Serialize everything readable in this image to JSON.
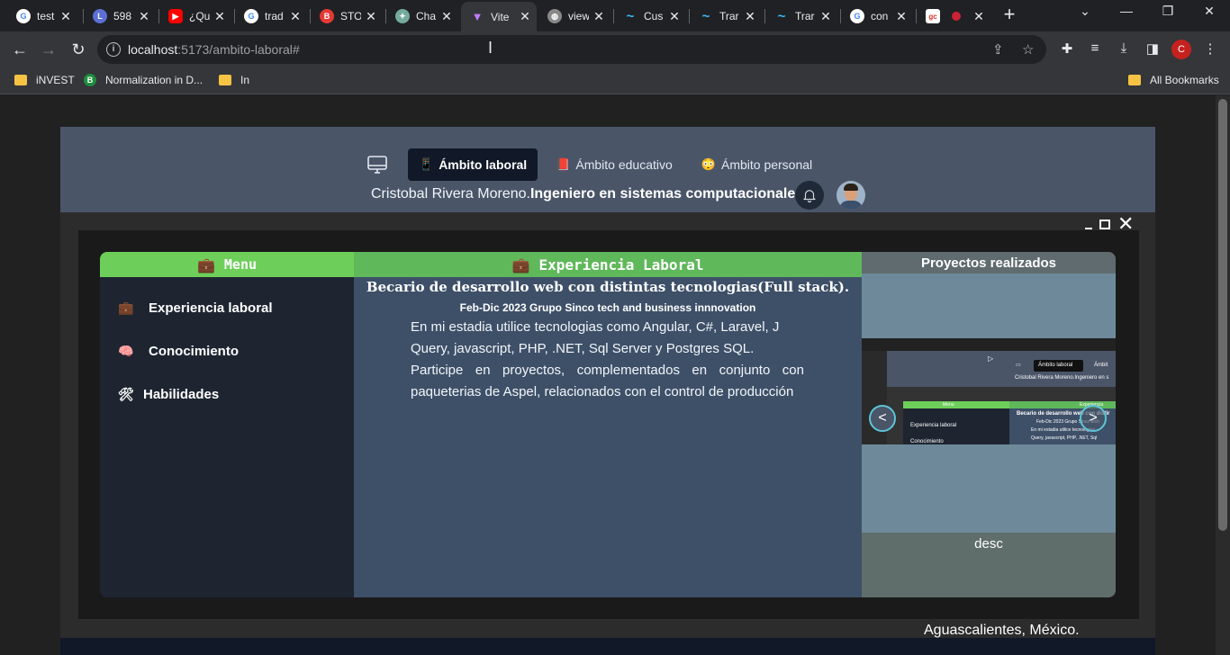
{
  "browser": {
    "tabs": [
      {
        "title": "test",
        "fav": "G",
        "color": "#4285f4"
      },
      {
        "title": "598",
        "fav": "L",
        "color": "#5b6fd6"
      },
      {
        "title": "¿Qu",
        "fav": "▶",
        "color": "#ff0000"
      },
      {
        "title": "trad",
        "fav": "G",
        "color": "#4285f4"
      },
      {
        "title": "STO",
        "fav": "B",
        "color": "#e53935"
      },
      {
        "title": "Cha",
        "fav": "✦",
        "color": "#74aa9c"
      },
      {
        "title": "Vite",
        "fav": "▼",
        "color": "#9c6bff"
      },
      {
        "title": "view",
        "fav": "◍",
        "color": "#888888"
      },
      {
        "title": "Cus",
        "fav": "~",
        "color": "#38bdf8"
      },
      {
        "title": "Trar",
        "fav": "~",
        "color": "#38bdf8"
      },
      {
        "title": "Trar",
        "fav": "~",
        "color": "#38bdf8"
      },
      {
        "title": "con",
        "fav": "G",
        "color": "#4285f4"
      },
      {
        "title": "",
        "fav": "gc",
        "color": "#d93025"
      }
    ],
    "url_host": "localhost",
    "url_path": ":5173/ambito-laboral#",
    "profile_initial": "C",
    "bookmarks": [
      "iNVEST",
      "Normalization in D...",
      "In"
    ],
    "all_bookmarks": "All Bookmarks"
  },
  "header": {
    "tabs": [
      {
        "emoji": "📱",
        "label": "Ámbito laboral"
      },
      {
        "emoji": "📕",
        "label": "Ámbito educativo"
      },
      {
        "emoji": "😳",
        "label": "Ámbito personal"
      }
    ],
    "name": "Cristobal Rivera Moreno.",
    "role": "Ingeniero en sistemas computacionales."
  },
  "menu": {
    "title": "Menu",
    "title_emoji": "💼",
    "items": [
      {
        "emoji": "💼",
        "label": "Experiencia laboral"
      },
      {
        "emoji": "🧠",
        "label": "Conocimiento"
      },
      {
        "emoji": "🛠",
        "label": "Habilidades"
      }
    ]
  },
  "experience": {
    "title": "Experiencia Laboral",
    "title_emoji": "💼",
    "job_title": "Becario de desarrollo web con distintas tecnologias(Full stack).",
    "subtitle": "Feb-Dic 2023 Grupo Sinco tech and business innnovation",
    "paragraph1": "En mi estadia utilice tecnologias como Angular, C#, Laravel, J Query, javascript, PHP, .NET, Sql Server y Postgres SQL.",
    "paragraph2": "Participe en proyectos, complementados en conjunto con paqueterias de Aspel, relacionados con el control de producción"
  },
  "projects": {
    "title": "Proyectos realizados",
    "desc": "desc",
    "prev": "<",
    "next": ">",
    "preview": {
      "tab_active": "Ámbito laboral",
      "tab_next": "Ámbit",
      "name_line": "Cristobal Rivera Moreno.Ingeniero en s",
      "menu": "Menu",
      "exp_hdr": "Experiencia",
      "exp_title": "Becario de desarrollo web con distir",
      "exp_sub": "Feb-Dic 2023 Grupo Sinco tech",
      "item1": "Experiencia laboral",
      "item2": "Conocimiento",
      "line1": "En mi estadia utilice tecnologias",
      "line2": "Query, javascript, PHP, .NET, Sql"
    }
  },
  "footer": {
    "location": "Aguascalientes, México."
  }
}
